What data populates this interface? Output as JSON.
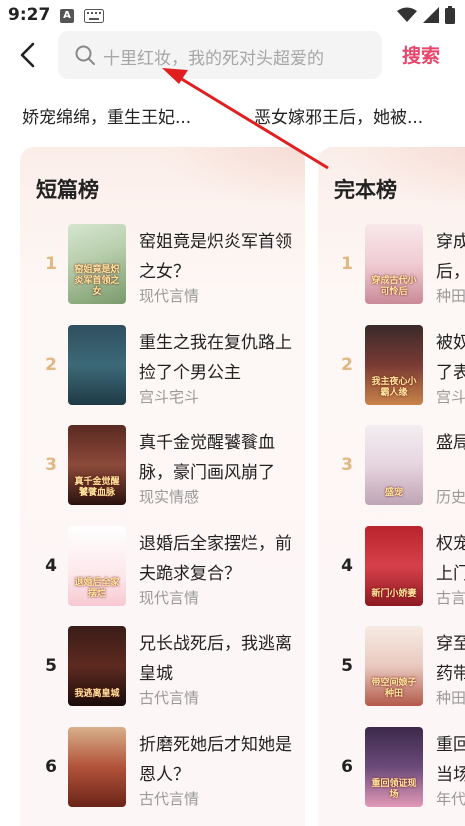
{
  "status_bar": {
    "time": "9:27",
    "notification_icon": "A",
    "icons": [
      "keyboard-icon",
      "wifi-icon",
      "signal-icon",
      "battery-icon"
    ]
  },
  "header": {
    "search_placeholder": "十里红妆，我的死对头超爱的",
    "search_button": "搜索"
  },
  "hot_tags": [
    "娇宠绵绵，重生王妃...",
    "恶女嫁邪王后，她被..."
  ],
  "colors": {
    "accent": "#e8456b",
    "rank_top": "#e0b882",
    "card_bg": "#fdf6f6",
    "annotation_arrow": "#e02020"
  },
  "short_list": {
    "title": "短篇榜",
    "books": [
      {
        "rank": "1",
        "title": "窑姐竟是炽炎军首领之女？",
        "genre": "现代言情",
        "cover": "cover-1",
        "cover_text": "窑姐竟是炽炎军首领之女"
      },
      {
        "rank": "2",
        "title": "重生之我在复仇路上捡了个男公主",
        "genre": "宫斗宅斗",
        "cover": "cover-2",
        "cover_text": ""
      },
      {
        "rank": "3",
        "title": "真千金觉醒饕餮血脉，豪门画风崩了",
        "genre": "现实情感",
        "cover": "cover-3",
        "cover_text": "真千金觉醒饕餮血脉"
      },
      {
        "rank": "4",
        "title": "退婚后全家摆烂，前夫跪求复合？",
        "genre": "现代言情",
        "cover": "cover-4",
        "cover_text": "退婚后全家摆烂"
      },
      {
        "rank": "5",
        "title": "兄长战死后，我逃离皇城",
        "genre": "古代言情",
        "cover": "cover-5",
        "cover_text": "我逃离皇城"
      },
      {
        "rank": "6",
        "title": "折磨死她后才知她是恩人？",
        "genre": "古代言情",
        "cover": "cover-6",
        "cover_text": ""
      }
    ]
  },
  "complete_list": {
    "title": "完本榜",
    "books": [
      {
        "rank": "1",
        "title": "穿成",
        "title2": "后，",
        "genre": "种田",
        "cover": "cover-c1",
        "cover_text": "穿成古代小可怜后"
      },
      {
        "rank": "2",
        "title": "被奴",
        "title2": "了表",
        "genre": "宫斗",
        "cover": "cover-c2",
        "cover_text": "我主夜心小霸人缘"
      },
      {
        "rank": "3",
        "title": "盛局",
        "title2": "",
        "genre": "历史",
        "cover": "cover-c3",
        "cover_text": "盛宠"
      },
      {
        "rank": "4",
        "title": "权宠",
        "title2": "上门",
        "genre": "古言",
        "cover": "cover-c4",
        "cover_text": "新门小娇妻"
      },
      {
        "rank": "5",
        "title": "穿至",
        "title2": "药带",
        "genre": "种田",
        "cover": "cover-c5",
        "cover_text": "带空间娘子种田"
      },
      {
        "rank": "6",
        "title": "重回",
        "title2": "当场",
        "genre": "年代",
        "cover": "cover-c6",
        "cover_text": "重回领证现场"
      }
    ]
  }
}
